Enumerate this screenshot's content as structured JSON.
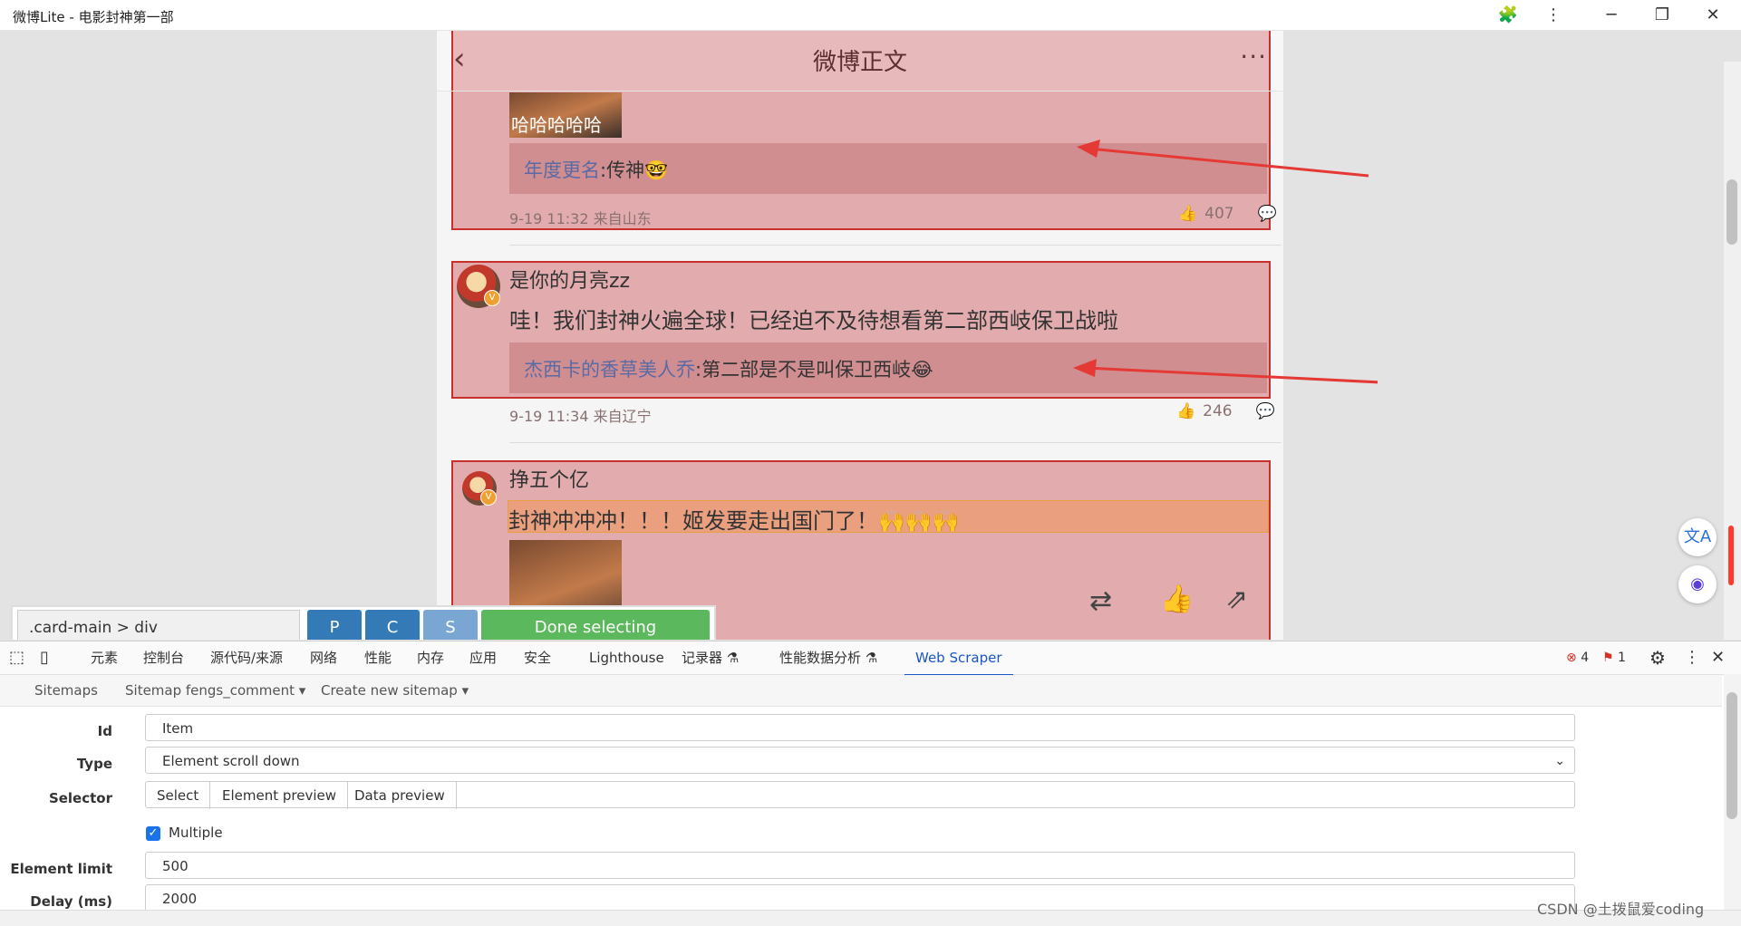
{
  "window": {
    "title": "微博Lite - 电影封神第一部"
  },
  "weibo": {
    "header_title": "微博正文",
    "back_glyph": "‹",
    "more_glyph": "···"
  },
  "comments": [
    {
      "image_caption": "哈哈哈哈哈",
      "reply_name": "年度更名",
      "reply_text": ":传神🤓",
      "time": "9-19 11:32 来自山东",
      "likes": "407"
    },
    {
      "nickname": "是你的月亮zz",
      "text": "哇！我们封神火遍全球！已经迫不及待想看第二部西岐保卫战啦",
      "reply_name": "杰西卡的香草美人乔",
      "reply_text": ":第二部是不是叫保卫西岐😂",
      "time": "9-19 11:34 来自辽宁",
      "likes": "246"
    },
    {
      "nickname": "挣五个亿",
      "text": "封神冲冲冲！！！姬发要走出国门了！🙌🙌🙌"
    }
  ],
  "selector_bar": {
    "selector": ".card-main > div",
    "btn_p": "P",
    "btn_c": "C",
    "btn_s": "S",
    "done": "Done selecting"
  },
  "devtools": {
    "tabs": [
      "元素",
      "控制台",
      "源代码/来源",
      "网络",
      "性能",
      "内存",
      "应用",
      "安全",
      "Lighthouse",
      "记录器 ⚗",
      "性能数据分析 ⚗",
      "Web Scraper"
    ],
    "errors": "4",
    "warnings": "1",
    "sub": {
      "sitemaps": "Sitemaps",
      "sitemap_name": "Sitemap fengs_comment ▾",
      "create": "Create new sitemap ▾"
    },
    "form": {
      "id_label": "Id",
      "id_value": "Item",
      "type_label": "Type",
      "type_value": "Element scroll down",
      "selector_label": "Selector",
      "select_btn": "Select",
      "preview_btn": "Element preview",
      "data_preview_btn": "Data preview",
      "multiple_label": "Multiple",
      "limit_label": "Element limit",
      "limit_value": "500",
      "delay_label": "Delay (ms)",
      "delay_value": "2000"
    }
  },
  "watermark": "CSDN @土拨鼠爱coding",
  "colors": {
    "highlight": "#c9302c",
    "done_green": "#5cb85c",
    "btn_blue": "#337ab7",
    "btn_light_blue": "#7aa6d3",
    "devtools_active": "#1a56c6"
  }
}
